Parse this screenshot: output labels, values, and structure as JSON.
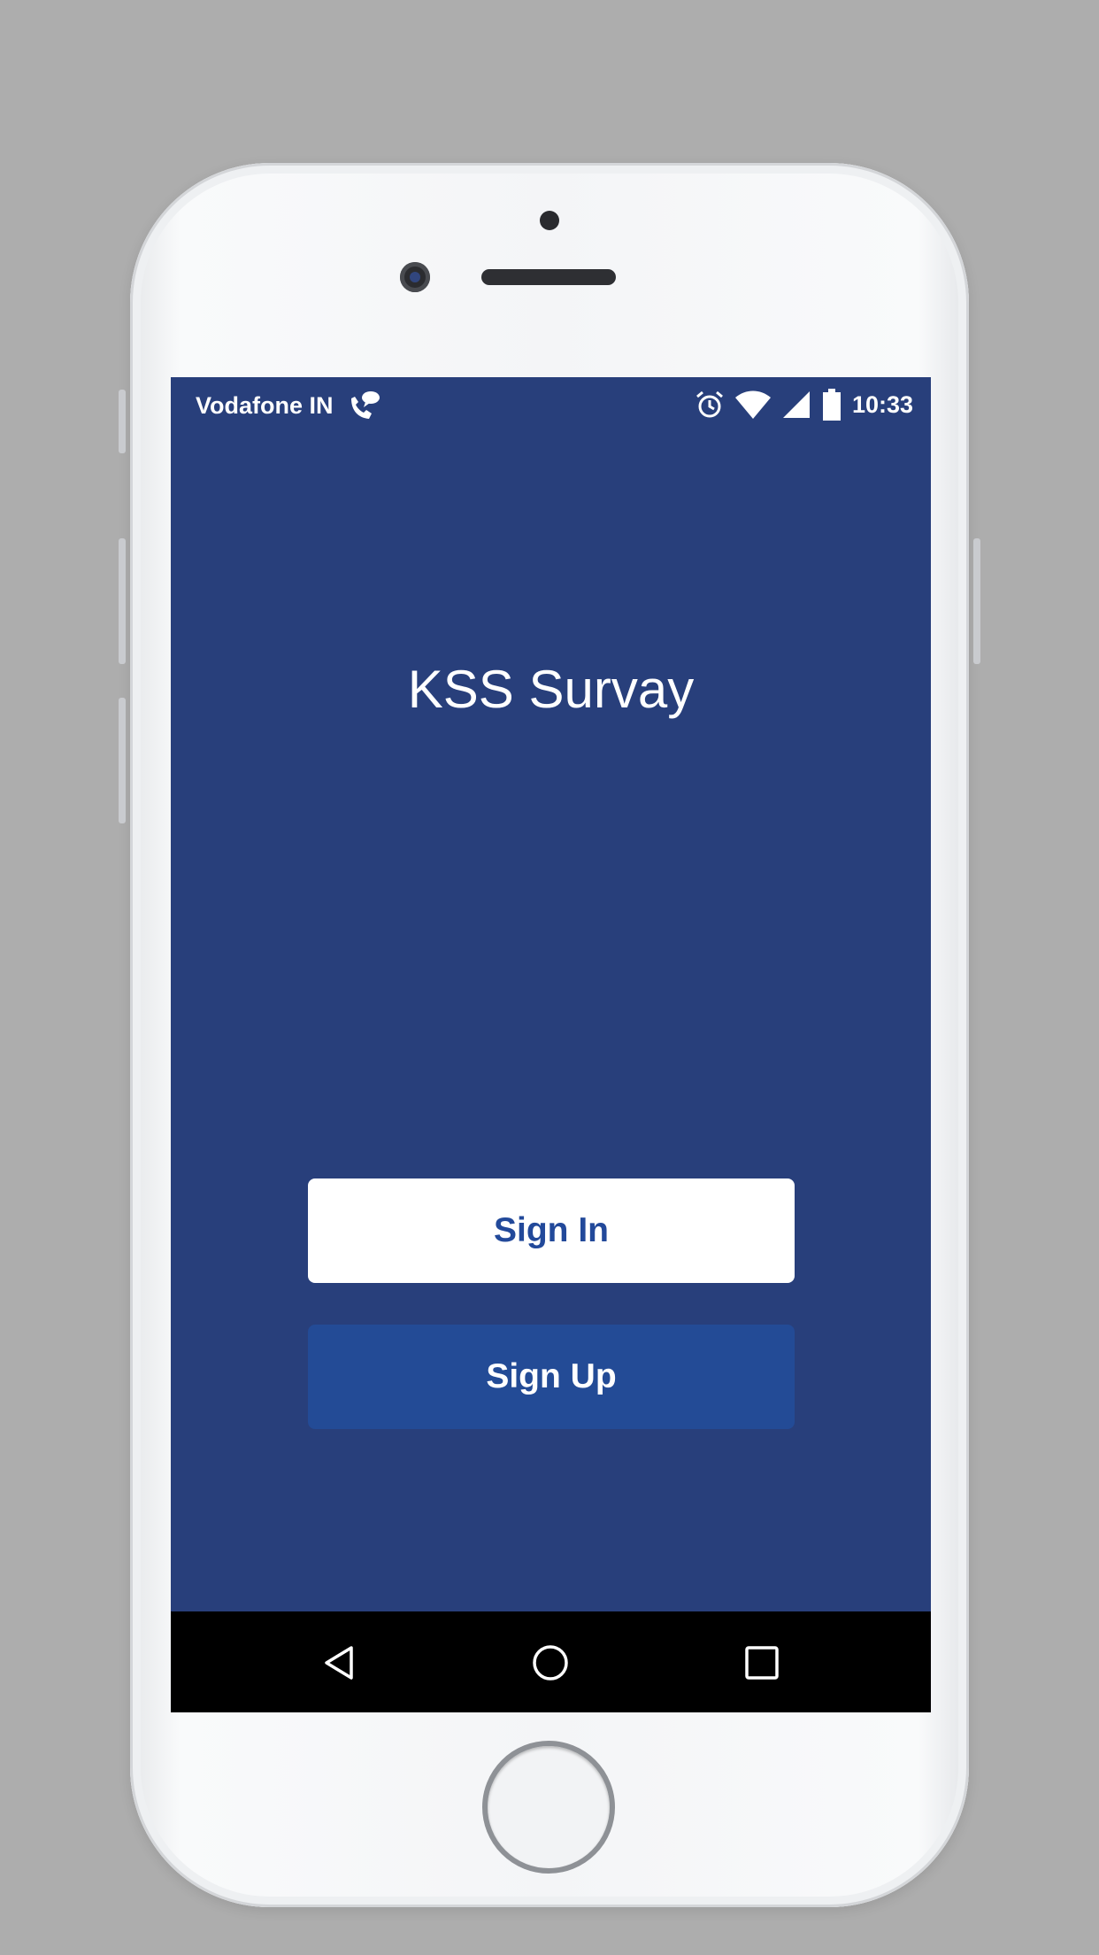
{
  "status_bar": {
    "carrier": "Vodafone IN",
    "time": "10:33",
    "icons": [
      "wifi-calling-icon",
      "alarm-icon",
      "wifi-icon",
      "cell-signal-icon",
      "battery-icon"
    ]
  },
  "app": {
    "title": "KSS Survay"
  },
  "buttons": {
    "sign_in": "Sign In",
    "sign_up": "Sign Up"
  },
  "nav_bar": {
    "icons": [
      "back-icon",
      "home-icon",
      "recents-icon"
    ]
  },
  "colors": {
    "background": "#283f7b",
    "sign_in_bg": "#ffffff",
    "sign_in_text": "#22499a",
    "sign_up_bg": "#234b96",
    "nav_bar": "#000000"
  }
}
